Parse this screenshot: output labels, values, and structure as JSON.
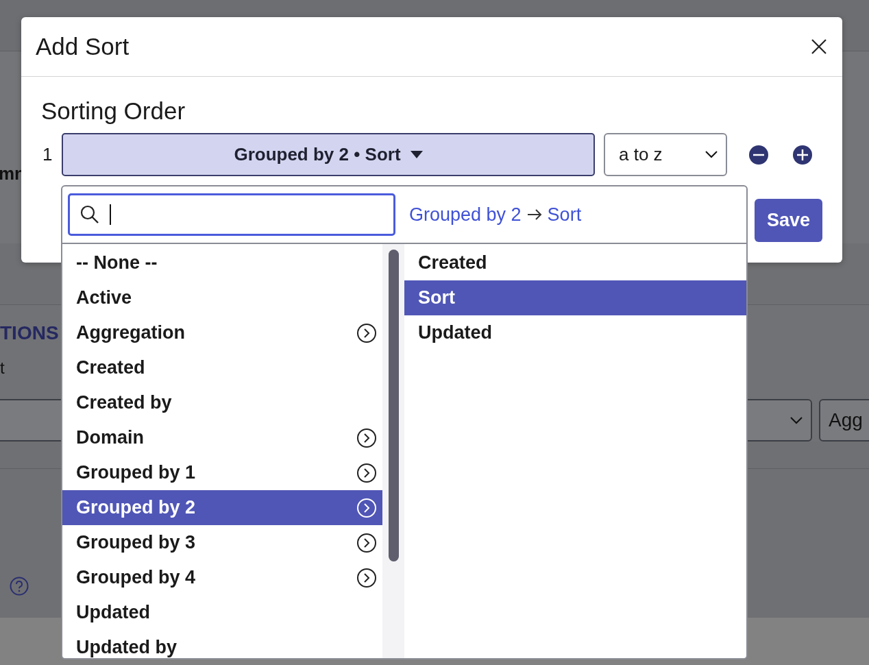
{
  "background_page": {
    "column_fragment": "mn",
    "section_heading": "TIONS",
    "label_fragment": "t",
    "select_fragment": "Agg"
  },
  "dialog": {
    "title": "Add Sort",
    "section_title": "Sorting Order",
    "sort_rows": [
      {
        "number": "1",
        "field": "Grouped by 2 • Sort",
        "direction": "a to z"
      }
    ],
    "save_button": "Save"
  },
  "field_menu": {
    "search": {
      "focused": true
    },
    "breadcrumb": [
      "Grouped by 2",
      "Sort"
    ],
    "left_items": [
      {
        "label": "-- None --",
        "has_children": false,
        "selected": false
      },
      {
        "label": "Active",
        "has_children": false,
        "selected": false
      },
      {
        "label": "Aggregation",
        "has_children": true,
        "selected": false
      },
      {
        "label": "Created",
        "has_children": false,
        "selected": false
      },
      {
        "label": "Created by",
        "has_children": false,
        "selected": false
      },
      {
        "label": "Domain",
        "has_children": true,
        "selected": false
      },
      {
        "label": "Grouped by 1",
        "has_children": true,
        "selected": false
      },
      {
        "label": "Grouped by 2",
        "has_children": true,
        "selected": true
      },
      {
        "label": "Grouped by 3",
        "has_children": true,
        "selected": false
      },
      {
        "label": "Grouped by 4",
        "has_children": true,
        "selected": false
      },
      {
        "label": "Updated",
        "has_children": false,
        "selected": false
      },
      {
        "label": "Updated by",
        "has_children": false,
        "selected": false
      }
    ],
    "right_items": [
      {
        "label": "Created",
        "selected": false
      },
      {
        "label": "Sort",
        "selected": true
      },
      {
        "label": "Updated",
        "selected": false
      }
    ]
  }
}
